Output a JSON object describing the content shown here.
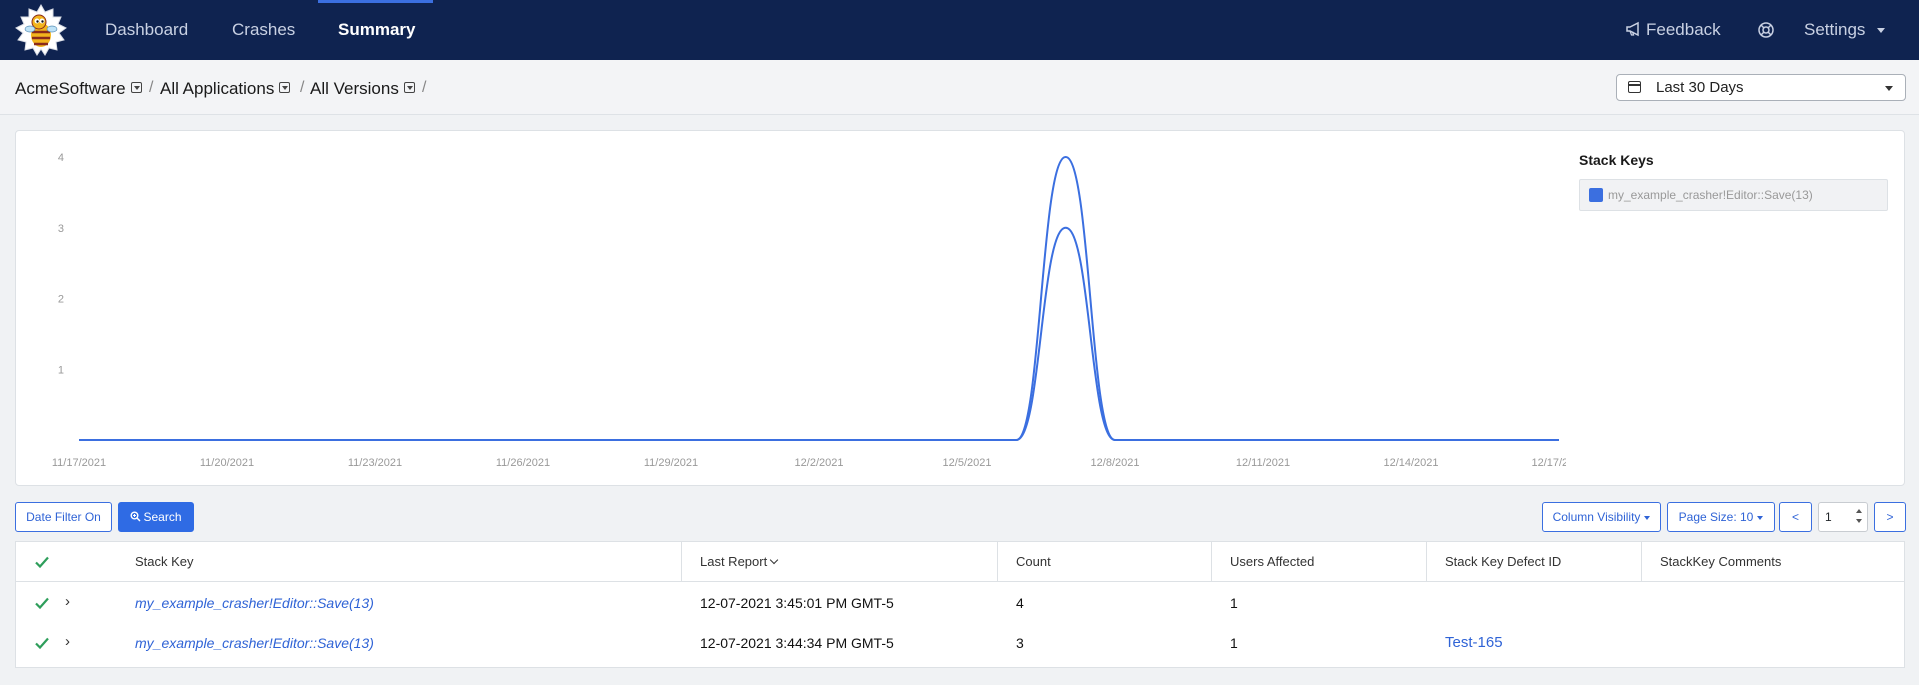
{
  "nav": {
    "items": [
      {
        "label": "Dashboard"
      },
      {
        "label": "Crashes"
      },
      {
        "label": "Summary"
      }
    ],
    "feedback_label": "Feedback",
    "settings_label": "Settings"
  },
  "breadcrumb": {
    "org": "AcmeSoftware",
    "app": "All Applications",
    "version": "All Versions",
    "separator": "/"
  },
  "date_range": {
    "selected": "Last 30 Days"
  },
  "chart_data": {
    "type": "line",
    "x": [
      "11/17/2021",
      "11/18/2021",
      "11/19/2021",
      "11/20/2021",
      "11/21/2021",
      "11/22/2021",
      "11/23/2021",
      "11/24/2021",
      "11/25/2021",
      "11/26/2021",
      "11/27/2021",
      "11/28/2021",
      "11/29/2021",
      "11/30/2021",
      "12/1/2021",
      "12/2/2021",
      "12/3/2021",
      "12/4/2021",
      "12/5/2021",
      "12/6/2021",
      "12/7/2021",
      "12/8/2021",
      "12/9/2021",
      "12/10/2021",
      "12/11/2021",
      "12/12/2021",
      "12/13/2021",
      "12/14/2021",
      "12/15/2021",
      "12/16/2021",
      "12/17/2021"
    ],
    "x_ticks": [
      "11/17/2021",
      "11/20/2021",
      "11/23/2021",
      "11/26/2021",
      "11/29/2021",
      "12/2/2021",
      "12/5/2021",
      "12/8/2021",
      "12/11/2021",
      "12/14/2021",
      "12/17/2021"
    ],
    "series": [
      {
        "name": "",
        "values": [
          0,
          0,
          0,
          0,
          0,
          0,
          0,
          0,
          0,
          0,
          0,
          0,
          0,
          0,
          0,
          0,
          0,
          0,
          0,
          0,
          4,
          0,
          0,
          0,
          0,
          0,
          0,
          0,
          0,
          0,
          0
        ]
      },
      {
        "name": "",
        "values": [
          0,
          0,
          0,
          0,
          0,
          0,
          0,
          0,
          0,
          0,
          0,
          0,
          0,
          0,
          0,
          0,
          0,
          0,
          0,
          0,
          3,
          0,
          0,
          0,
          0,
          0,
          0,
          0,
          0,
          0,
          0
        ]
      }
    ],
    "yticks": [
      1,
      2,
      3,
      4
    ],
    "ylim": [
      0,
      4
    ],
    "line_color": "#3b6fe0",
    "legend_title": "Stack Keys",
    "legend_entries": [
      "my_example_crasher!Editor::Save(13)"
    ],
    "legend_placement": "right",
    "grid": false
  },
  "toolbar": {
    "date_filter_label": "Date Filter On",
    "search_label": "Search",
    "column_visibility_label": "Column Visibility",
    "page_size_label": "Page Size: 10",
    "prev_label": "<",
    "next_label": ">",
    "page_value": "1"
  },
  "table": {
    "headers": {
      "stack_key": "Stack Key",
      "last_report": "Last Report",
      "count": "Count",
      "users_affected": "Users Affected",
      "defect_id": "Stack Key Defect ID",
      "comments": "StackKey Comments"
    },
    "rows": [
      {
        "stack_key": "my_example_crasher!Editor::Save(13)",
        "last_report": "12-07-2021 3:45:01 PM GMT-5",
        "count": "4",
        "users_affected": "1",
        "defect_id": "",
        "comments": ""
      },
      {
        "stack_key": "my_example_crasher!Editor::Save(13)",
        "last_report": "12-07-2021 3:44:34 PM GMT-5",
        "count": "3",
        "users_affected": "1",
        "defect_id": "Test-165",
        "comments": ""
      }
    ]
  },
  "colors": {
    "navbar": "#0f2350",
    "accent": "#3b6fe0",
    "check_green": "#2e9e5b"
  }
}
